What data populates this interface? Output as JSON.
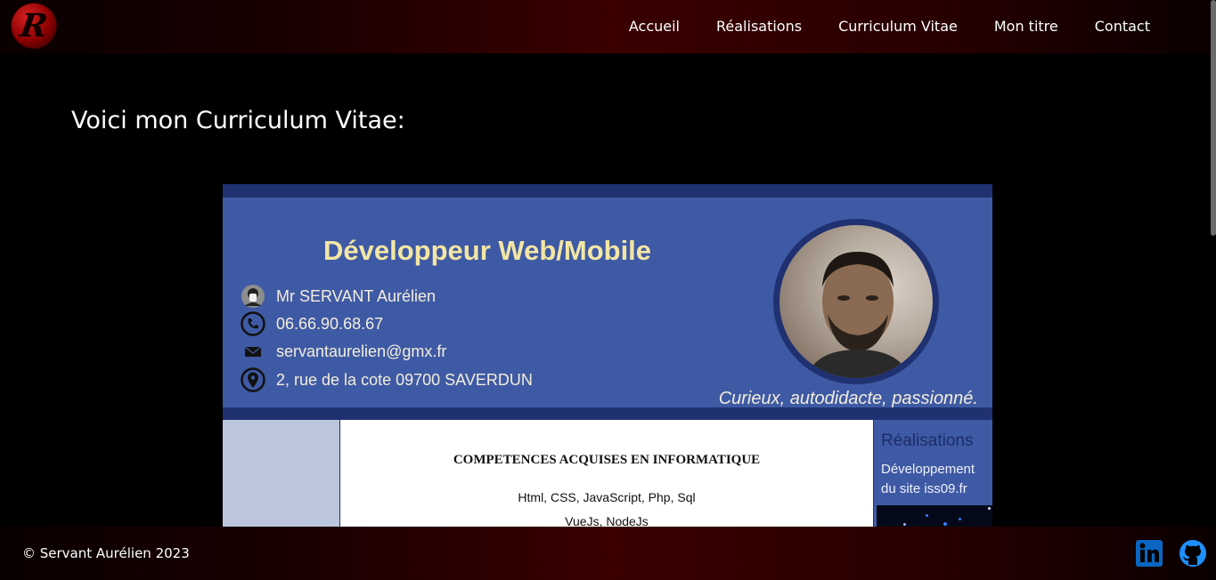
{
  "header": {
    "logo_letter": "R",
    "nav": [
      "Accueil",
      "Réalisations",
      "Curriculum Vitae",
      "Mon titre",
      "Contact"
    ]
  },
  "main": {
    "title": "Voici mon Curriculum Vitae:"
  },
  "cv": {
    "headline": "Développeur Web/Mobile",
    "contacts": [
      {
        "icon": "person-icon",
        "text": "Mr SERVANT Aurélien"
      },
      {
        "icon": "phone-icon",
        "text": "06.66.90.68.67"
      },
      {
        "icon": "mail-icon",
        "text": "servantaurelien@gmx.fr"
      },
      {
        "icon": "location-icon",
        "text": "2, rue de la cote 09700 SAVERDUN"
      }
    ],
    "motto": "Curieux, autodidacte, passionné.",
    "skills_title": "COMPETENCES ACQUISES EN INFORMATIQUE",
    "skills": [
      "Html, CSS, JavaScript, Php, Sql",
      "VueJs, NodeJs"
    ],
    "realisations_title": "Réalisations",
    "realisations_text": "Développement du site iss09.fr"
  },
  "footer": {
    "copyright": "© Servant Aurélien 2023",
    "social": [
      {
        "icon": "linkedin-icon",
        "color": "#0a66c2"
      },
      {
        "icon": "github-icon",
        "color": "#1e90ff"
      }
    ]
  },
  "colors": {
    "cv_blue": "#3f5aa5",
    "cv_dark_blue": "#1f3170",
    "headline_yellow": "#f3e6a4"
  }
}
